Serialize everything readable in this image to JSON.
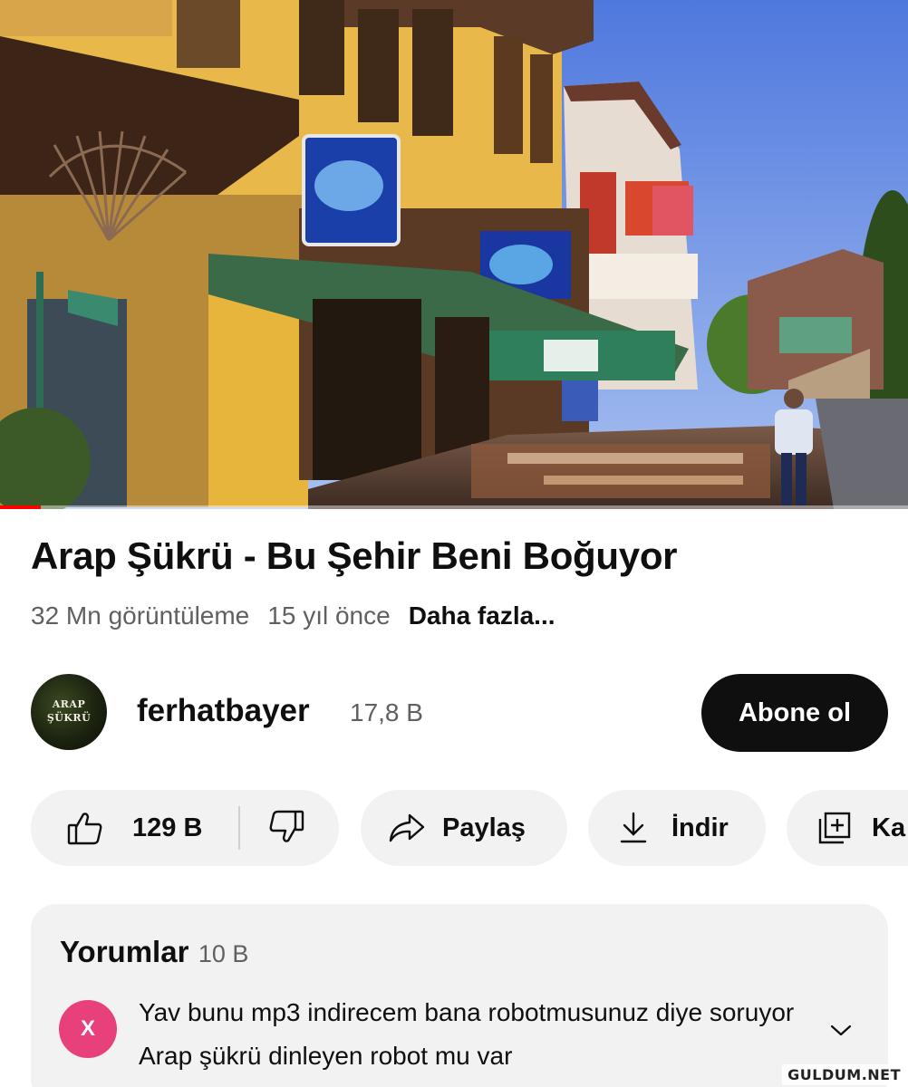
{
  "video": {
    "progress": 0.045,
    "accent_color": "#ff0000"
  },
  "title": "Arap Şükrü - Bu Şehir Beni Boğuyor",
  "meta": {
    "views": "32 Mn görüntüleme",
    "age": "15 yıl önce",
    "more": "Daha fazla..."
  },
  "channel": {
    "avatar_line1": "ARAP",
    "avatar_line2": "ŞÜKRÜ",
    "name": "ferhatbayer",
    "subscribers": "17,8 B",
    "subscribe_label": "Abone ol"
  },
  "actions": {
    "like_count": "129 B",
    "like_icon": "thumbs-up-icon",
    "dislike_icon": "thumbs-down-icon",
    "share_label": "Paylaş",
    "share_icon": "share-arrow-icon",
    "download_label": "İndir",
    "download_icon": "download-icon",
    "save_label": "Ka",
    "save_icon": "add-to-playlist-icon"
  },
  "comments": {
    "label": "Yorumlar",
    "count": "10 B",
    "top_comment": {
      "avatar_letter": "X",
      "avatar_color": "#e8407a",
      "text": "Yav bunu mp3 indirecem bana robotmusunuz diye soruyor Arap şükrü dinleyen robot mu var"
    }
  },
  "watermark": "GULDUM.NET"
}
